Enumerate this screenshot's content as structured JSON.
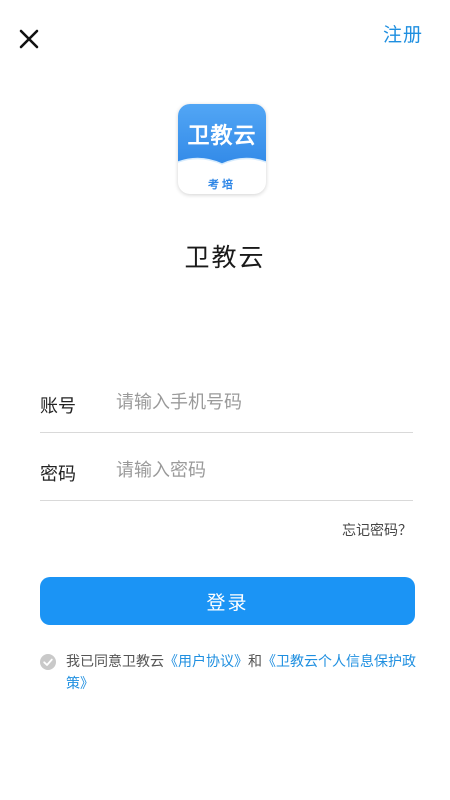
{
  "header": {
    "close_icon": "close-icon",
    "register_label": "注册"
  },
  "logo": {
    "title": "卫教云",
    "subtitle": "考培",
    "colors": {
      "top": "#3f95ee",
      "text": "#2e86e6"
    }
  },
  "app_name": "卫教云",
  "form": {
    "account": {
      "label": "账号",
      "placeholder": "请输入手机号码",
      "value": ""
    },
    "password": {
      "label": "密码",
      "placeholder": "请输入密码",
      "value": ""
    },
    "forgot_label": "忘记密码？"
  },
  "login_label": "登录",
  "agreement": {
    "prefix": "我已同意卫教云",
    "user_agreement": "《用户协议》",
    "conjunction": "和",
    "privacy_policy": "《卫教云个人信息保护政策》",
    "checked": false
  },
  "colors": {
    "accent": "#1b94f5",
    "link": "#1f8fe0",
    "divider": "#d9d9d9",
    "check": "#c9c9c9"
  }
}
